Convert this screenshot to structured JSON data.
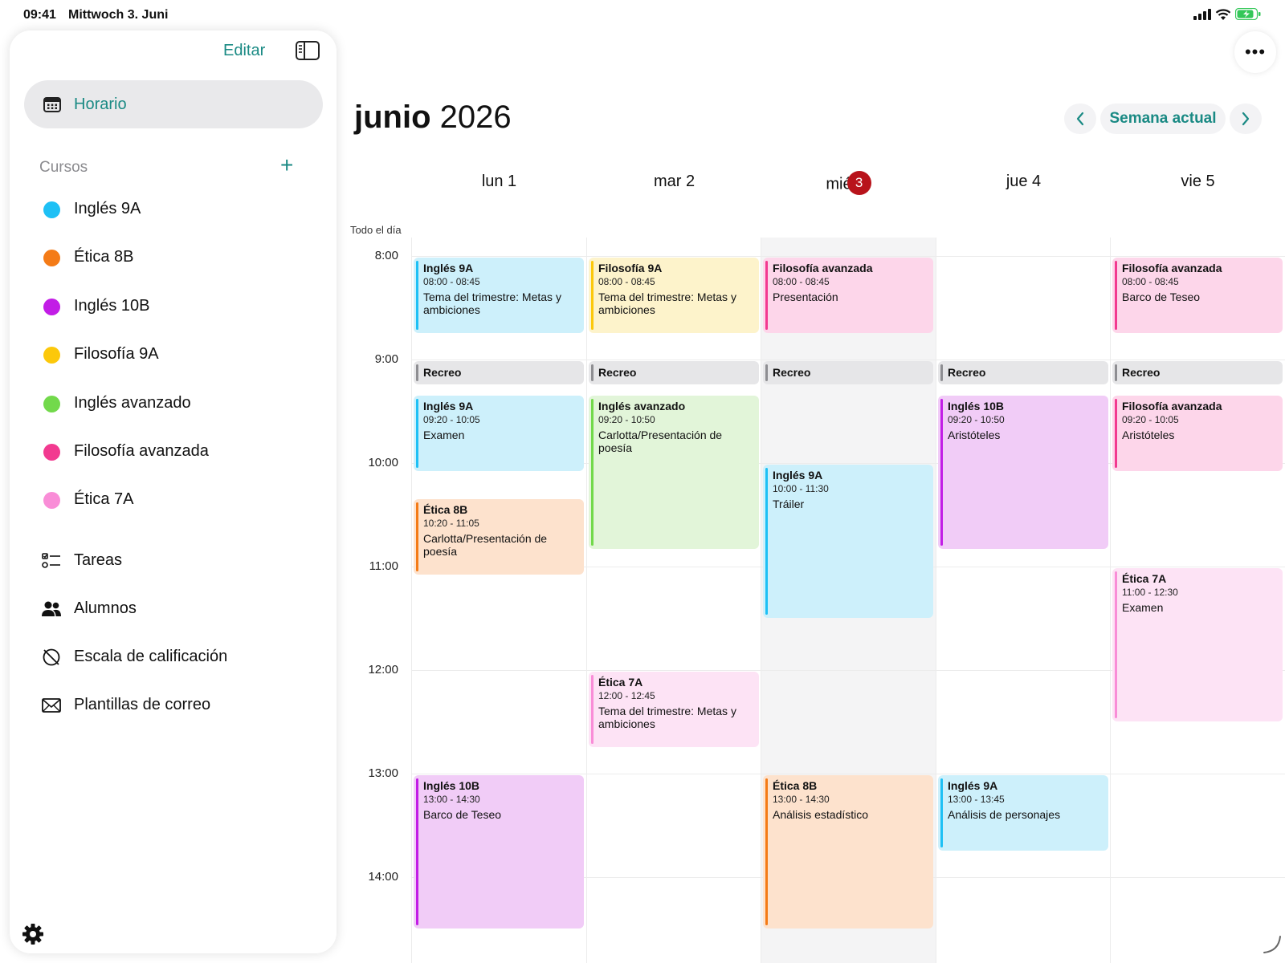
{
  "status": {
    "time": "09:41",
    "date": "Mittwoch 3. Juni"
  },
  "sidebar": {
    "edit_label": "Editar",
    "schedule_label": "Horario",
    "courses_heading": "Cursos",
    "add_symbol": "+",
    "courses": [
      {
        "name": "Inglés 9A",
        "color": "#1ec0f5"
      },
      {
        "name": "Ética 8B",
        "color": "#f47b17"
      },
      {
        "name": "Inglés 10B",
        "color": "#c21de6"
      },
      {
        "name": "Filosofía 9A",
        "color": "#fcc80b"
      },
      {
        "name": "Inglés avanzado",
        "color": "#72d94b"
      },
      {
        "name": "Filosofía avanzada",
        "color": "#f23a90"
      },
      {
        "name": "Ética 7A",
        "color": "#f98dd7"
      }
    ],
    "nav": [
      {
        "name": "Tareas",
        "icon": "tasks-icon"
      },
      {
        "name": "Alumnos",
        "icon": "students-icon"
      },
      {
        "name": "Escala de calificación",
        "icon": "grading-scale-icon"
      },
      {
        "name": "Plantillas de correo",
        "icon": "mail-icon"
      }
    ]
  },
  "header": {
    "month": "junio",
    "year": "2026",
    "current_week_label": "Semana actual",
    "more_symbol": "•••"
  },
  "calendar": {
    "all_day_label": "Todo el día",
    "days": [
      {
        "label": "lun 1"
      },
      {
        "label": "mar 2"
      },
      {
        "label": "mié",
        "today_number": "3"
      },
      {
        "label": "jue 4"
      },
      {
        "label": "vie 5"
      }
    ],
    "hours": [
      "8:00",
      "9:00",
      "10:00",
      "11:00",
      "12:00",
      "13:00",
      "14:00"
    ],
    "events": [
      {
        "day": 0,
        "start": "08:00",
        "end": "08:45",
        "title": "Inglés 9A",
        "time": "08:00 - 08:45",
        "desc": "Tema del trimestre: Metas y ambiciones",
        "bg": "#cdf0fb",
        "bar": "#1ec0f5"
      },
      {
        "day": 1,
        "start": "08:00",
        "end": "08:45",
        "title": "Filosofía 9A",
        "time": "08:00 - 08:45",
        "desc": "Tema del trimestre: Metas y ambiciones",
        "bg": "#fdf3cb",
        "bar": "#fcc80b"
      },
      {
        "day": 2,
        "start": "08:00",
        "end": "08:45",
        "title": "Filosofía avanzada",
        "time": "08:00 - 08:45",
        "desc": "Presentación",
        "bg": "#fdd6ea",
        "bar": "#f23a90"
      },
      {
        "day": 4,
        "start": "08:00",
        "end": "08:45",
        "title": "Filosofía avanzada",
        "time": "08:00 - 08:45",
        "desc": "Barco de Teseo",
        "bg": "#fdd6ea",
        "bar": "#f23a90"
      },
      {
        "day": 0,
        "start": "09:00",
        "end": "09:15",
        "title": "Recreo",
        "recreo": true,
        "bg": "#e6e6e8",
        "bar": "#8e8e92"
      },
      {
        "day": 1,
        "start": "09:00",
        "end": "09:15",
        "title": "Recreo",
        "recreo": true,
        "bg": "#e6e6e8",
        "bar": "#8e8e92"
      },
      {
        "day": 2,
        "start": "09:00",
        "end": "09:15",
        "title": "Recreo",
        "recreo": true,
        "bg": "#e6e6e8",
        "bar": "#8e8e92"
      },
      {
        "day": 3,
        "start": "09:00",
        "end": "09:15",
        "title": "Recreo",
        "recreo": true,
        "bg": "#e6e6e8",
        "bar": "#8e8e92"
      },
      {
        "day": 4,
        "start": "09:00",
        "end": "09:15",
        "title": "Recreo",
        "recreo": true,
        "bg": "#e6e6e8",
        "bar": "#8e8e92"
      },
      {
        "day": 0,
        "start": "09:20",
        "end": "10:05",
        "title": "Inglés 9A",
        "time": "09:20 - 10:05",
        "desc": "Examen",
        "bg": "#cdf0fb",
        "bar": "#1ec0f5"
      },
      {
        "day": 1,
        "start": "09:20",
        "end": "10:50",
        "title": "Inglés avanzado",
        "time": "09:20 - 10:50",
        "desc": "Carlotta/Presentación de poesía",
        "bg": "#e2f5d9",
        "bar": "#72d94b"
      },
      {
        "day": 3,
        "start": "09:20",
        "end": "10:50",
        "title": "Inglés 10B",
        "time": "09:20 - 10:50",
        "desc": "Aristóteles",
        "bg": "#f1ccf7",
        "bar": "#c21de6"
      },
      {
        "day": 4,
        "start": "09:20",
        "end": "10:05",
        "title": "Filosofía avanzada",
        "time": "09:20 - 10:05",
        "desc": "Aristóteles",
        "bg": "#fdd6ea",
        "bar": "#f23a90"
      },
      {
        "day": 2,
        "start": "10:00",
        "end": "11:30",
        "title": "Inglés 9A",
        "time": "10:00 - 11:30",
        "desc": "Tráiler",
        "bg": "#cdf0fb",
        "bar": "#1ec0f5"
      },
      {
        "day": 0,
        "start": "10:20",
        "end": "11:05",
        "title": "Ética 8B",
        "time": "10:20 - 11:05",
        "desc": "Carlotta/Presentación de poesía",
        "bg": "#fde2cd",
        "bar": "#f47b17"
      },
      {
        "day": 4,
        "start": "11:00",
        "end": "12:30",
        "title": "Ética 7A",
        "time": "11:00 - 12:30",
        "desc": "Examen",
        "bg": "#fde3f5",
        "bar": "#f98dd7"
      },
      {
        "day": 1,
        "start": "12:00",
        "end": "12:45",
        "title": "Ética 7A",
        "time": "12:00 - 12:45",
        "desc": "Tema del trimestre: Metas y ambiciones",
        "bg": "#fde3f5",
        "bar": "#f98dd7"
      },
      {
        "day": 0,
        "start": "13:00",
        "end": "14:30",
        "title": "Inglés 10B",
        "time": "13:00 - 14:30",
        "desc": "Barco de Teseo",
        "bg": "#f1ccf7",
        "bar": "#c21de6"
      },
      {
        "day": 2,
        "start": "13:00",
        "end": "14:30",
        "title": "Ética 8B",
        "time": "13:00 - 14:30",
        "desc": "Análisis estadístico",
        "bg": "#fde2cd",
        "bar": "#f47b17"
      },
      {
        "day": 3,
        "start": "13:00",
        "end": "13:45",
        "title": "Inglés 9A",
        "time": "13:00 - 13:45",
        "desc": "Análisis de personajes",
        "bg": "#cdf0fb",
        "bar": "#1ec0f5"
      }
    ]
  }
}
